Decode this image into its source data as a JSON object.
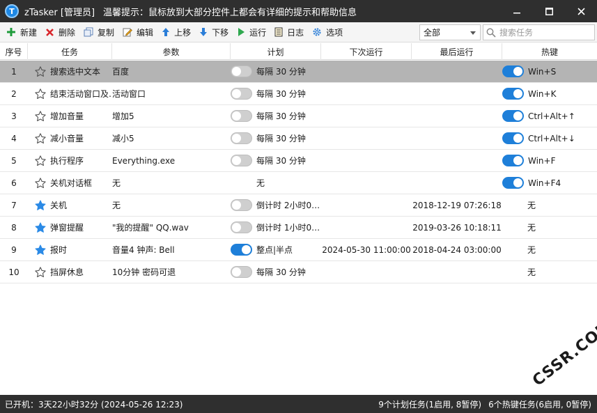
{
  "window": {
    "app_title": "zTasker [管理员]",
    "hint": "温馨提示：鼠标放到大部分控件上都会有详细的提示和帮助信息"
  },
  "toolbar": {
    "new_label": "新建",
    "delete_label": "删除",
    "copy_label": "复制",
    "edit_label": "编辑",
    "up_label": "上移",
    "down_label": "下移",
    "run_label": "运行",
    "log_label": "日志",
    "options_label": "选项",
    "filter_value": "全部",
    "search_placeholder": "搜索任务"
  },
  "columns": {
    "no": "序号",
    "task": "任务",
    "param": "参数",
    "plan": "计划",
    "next": "下次运行",
    "last": "最后运行",
    "hotkey": "热键"
  },
  "rows": [
    {
      "no": "1",
      "task": "搜索选中文本",
      "param": "百度",
      "plan": "每隔 30 分钟",
      "next": "",
      "last": "",
      "hotkey": "Win+S",
      "starred": false,
      "plan_on": false,
      "hot_on": true,
      "selected": true
    },
    {
      "no": "2",
      "task": "结束活动窗口及…",
      "param": "活动窗口",
      "plan": "每隔 30 分钟",
      "next": "",
      "last": "",
      "hotkey": "Win+K",
      "starred": false,
      "plan_on": false,
      "hot_on": true,
      "selected": false
    },
    {
      "no": "3",
      "task": "增加音量",
      "param": "增加5",
      "plan": "每隔 30 分钟",
      "next": "",
      "last": "",
      "hotkey": "Ctrl+Alt+↑",
      "starred": false,
      "plan_on": false,
      "hot_on": true,
      "selected": false
    },
    {
      "no": "4",
      "task": "减小音量",
      "param": "减小5",
      "plan": "每隔 30 分钟",
      "next": "",
      "last": "",
      "hotkey": "Ctrl+Alt+↓",
      "starred": false,
      "plan_on": false,
      "hot_on": true,
      "selected": false
    },
    {
      "no": "5",
      "task": "执行程序",
      "param": "Everything.exe",
      "plan": "每隔 30 分钟",
      "next": "",
      "last": "",
      "hotkey": "Win+F",
      "starred": false,
      "plan_on": false,
      "hot_on": true,
      "selected": false
    },
    {
      "no": "6",
      "task": "关机对话框",
      "param": "无",
      "plan": "无",
      "next": "",
      "last": "",
      "hotkey": "Win+F4",
      "starred": false,
      "plan_on": null,
      "hot_on": true,
      "selected": false
    },
    {
      "no": "7",
      "task": "关机",
      "param": "无",
      "plan": "倒计时 2小时0…",
      "next": "",
      "last": "2018-12-19 07:26:18",
      "hotkey": "无",
      "starred": true,
      "plan_on": false,
      "hot_on": null,
      "selected": false
    },
    {
      "no": "8",
      "task": "弹窗提醒",
      "param": "\"我的提醒\" QQ.wav",
      "plan": "倒计时 1小时0…",
      "next": "",
      "last": "2019-03-26 10:18:11",
      "hotkey": "无",
      "starred": true,
      "plan_on": false,
      "hot_on": null,
      "selected": false
    },
    {
      "no": "9",
      "task": "报时",
      "param": "音量4 钟声: Bell",
      "plan": "整点|半点",
      "next": "2024-05-30 11:00:00",
      "last": "2018-04-24 03:00:00",
      "hotkey": "无",
      "starred": true,
      "plan_on": true,
      "hot_on": null,
      "selected": false
    },
    {
      "no": "10",
      "task": "挡屏休息",
      "param": "10分钟 密码可退",
      "plan": "每隔 30 分钟",
      "next": "",
      "last": "",
      "hotkey": "无",
      "starred": false,
      "plan_on": false,
      "hot_on": null,
      "selected": false
    }
  ],
  "status": {
    "uptime": "已开机：3天22小时32分 (2024-05-26 12:23)",
    "plan_tasks": "9个计划任务(1启用, 8暂停)",
    "hotkey_tasks": "6个热键任务(6启用, 0暂停)"
  },
  "watermark": "CSSR.COM",
  "colors": {
    "titlebar": "#2f2f2f",
    "accent": "#1e7fd9",
    "selected_row": "#b4b4b4"
  }
}
